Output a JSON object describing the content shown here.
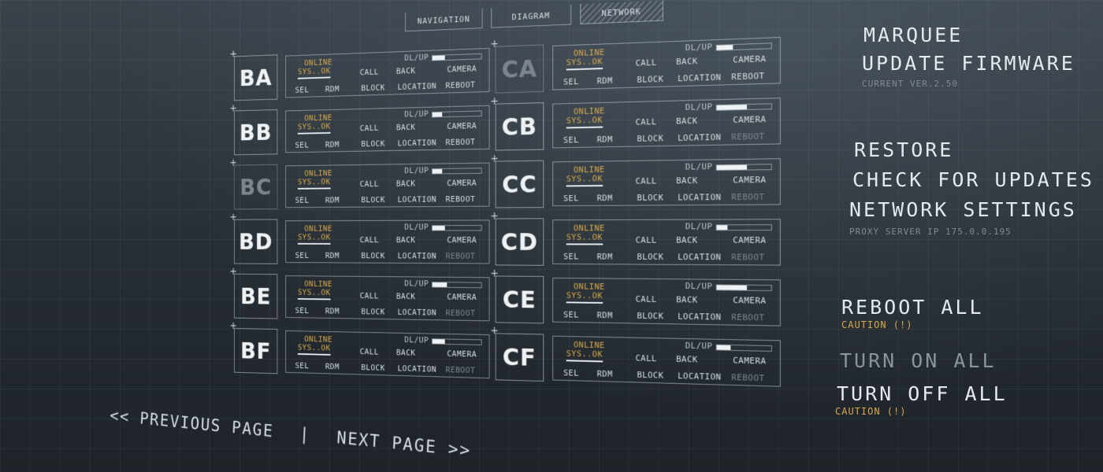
{
  "nav": {
    "tabs": [
      {
        "label": "NAVIGATION",
        "active": false
      },
      {
        "label": "DIAGRAM",
        "active": false
      },
      {
        "label": "NETWORK",
        "active": true
      }
    ]
  },
  "panel_labels": {
    "online": "ONLINE",
    "sys": "SYS..OK",
    "dlup": "DL/UP",
    "call": "CALL",
    "back": "BACK",
    "camera": "CAMERA",
    "sel": "SEL",
    "rdm": "RDM",
    "block": "BLOCK",
    "location": "LOCATION",
    "reboot": "REBOOT"
  },
  "columns": [
    {
      "rows": [
        {
          "id": "BA",
          "dim": false,
          "progress": 0.25,
          "reboot_dim": false
        },
        {
          "id": "BB",
          "dim": false,
          "progress": 0.2,
          "reboot_dim": false
        },
        {
          "id": "BC",
          "dim": true,
          "progress": 0.2,
          "reboot_dim": false
        },
        {
          "id": "BD",
          "dim": false,
          "progress": 0.25,
          "reboot_dim": true
        },
        {
          "id": "BE",
          "dim": false,
          "progress": 0.3,
          "reboot_dim": true
        },
        {
          "id": "BF",
          "dim": false,
          "progress": 0.25,
          "reboot_dim": true
        }
      ]
    },
    {
      "rows": [
        {
          "id": "CA",
          "dim": true,
          "progress": 0.3,
          "reboot_dim": false
        },
        {
          "id": "CB",
          "dim": false,
          "progress": 0.55,
          "reboot_dim": true
        },
        {
          "id": "CC",
          "dim": false,
          "progress": 0.55,
          "reboot_dim": true
        },
        {
          "id": "CD",
          "dim": false,
          "progress": 0.2,
          "reboot_dim": true
        },
        {
          "id": "CE",
          "dim": false,
          "progress": 0.55,
          "reboot_dim": true
        },
        {
          "id": "CF",
          "dim": false,
          "progress": 0.25,
          "reboot_dim": true
        }
      ]
    }
  ],
  "pager": {
    "previous": "<< PREVIOUS PAGE",
    "separator": "|",
    "next": "NEXT PAGE >>"
  },
  "menu": {
    "marquee": "MARQUEE",
    "update_firmware": "UPDATE FIRMWARE",
    "current_version": "CURRENT VER.2.50",
    "restore": "RESTORE",
    "check_updates": "CHECK FOR UPDATES",
    "network_settings": "NETWORK SETTINGS",
    "proxy_ip": "PROXY SERVER IP 175.0.0.195",
    "reboot_all": "REBOOT ALL",
    "caution_1": "CAUTION (!)",
    "turn_on_all": "TURN ON ALL",
    "turn_off_all": "TURN OFF ALL",
    "caution_2": "CAUTION (!)"
  },
  "colors": {
    "accent": "#d4a84c",
    "text": "#d6dde3",
    "background": "#242a30"
  }
}
